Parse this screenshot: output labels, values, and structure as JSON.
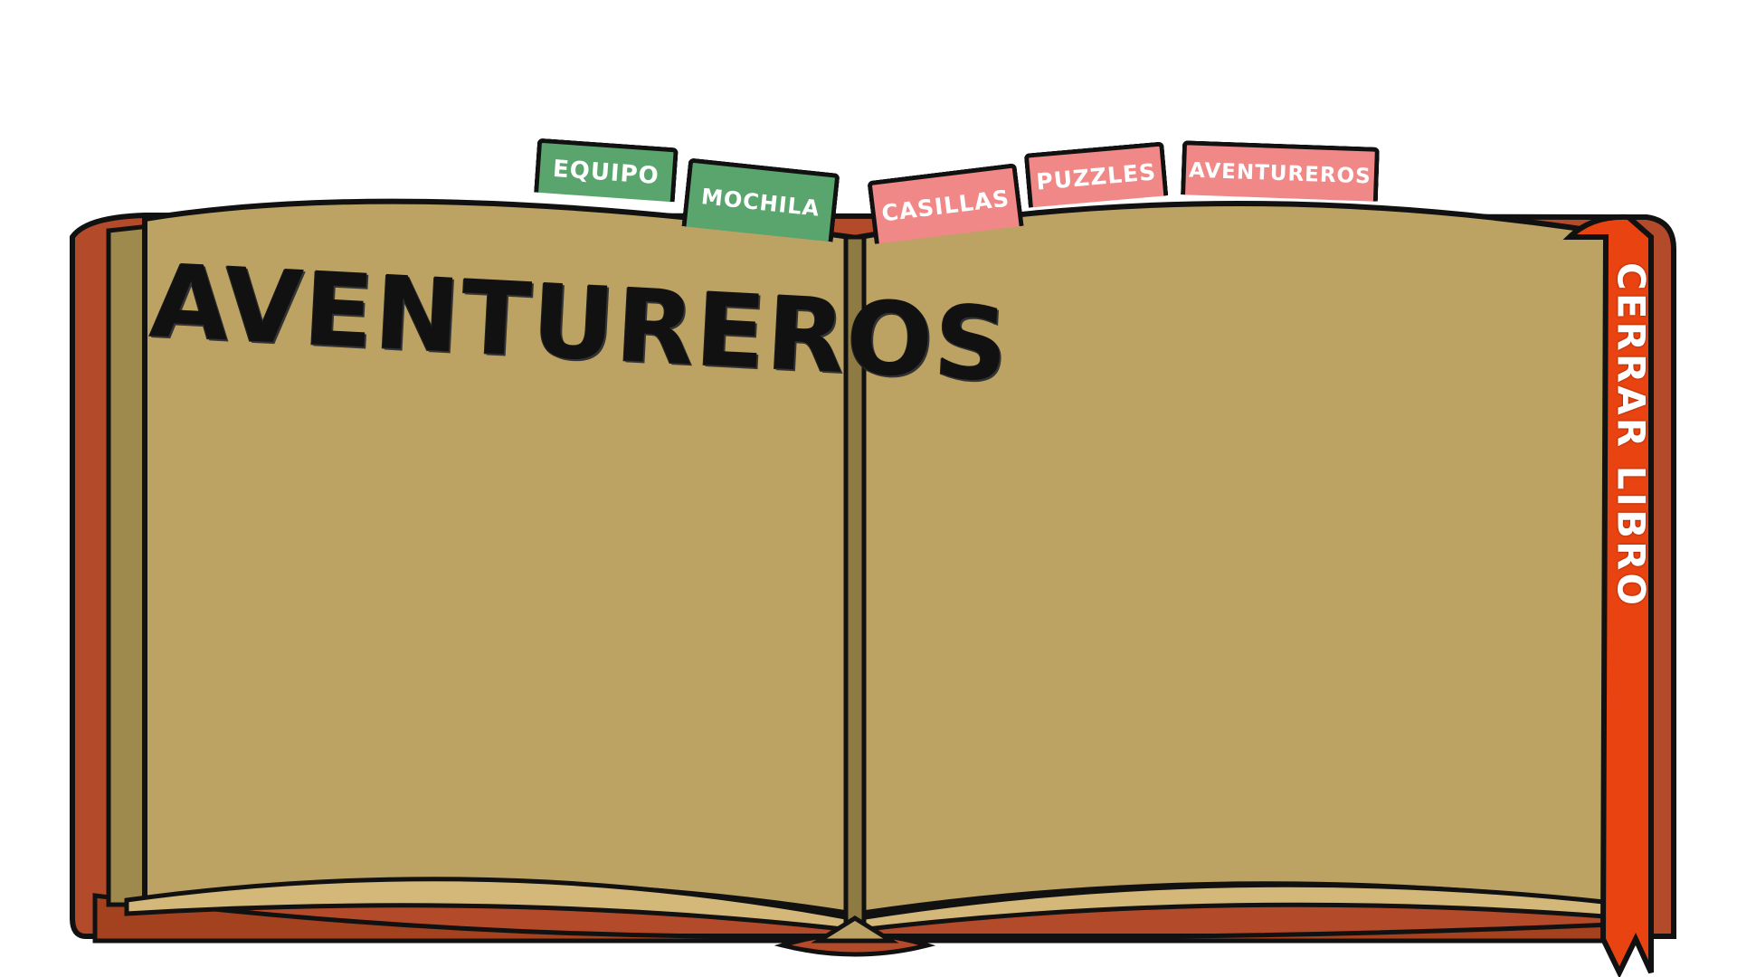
{
  "book": {
    "title": "AVENTUREROS",
    "tabs": [
      {
        "label": "EQUIPO",
        "color": "#5aa56e"
      },
      {
        "label": "MOCHILA",
        "color": "#5aa56e"
      },
      {
        "label": "CASILLAS",
        "color": "#f08888"
      },
      {
        "label": "PUZZLES",
        "color": "#f08888"
      },
      {
        "label": "AVENTUREROS",
        "color": "#f08888"
      }
    ],
    "bookmark": {
      "label": "CERRAR LIBRO",
      "color": "#e84310"
    }
  },
  "colors": {
    "page": "#bca363",
    "page_edge": "#d3b87a",
    "cover": "#b34a2a",
    "outline": "#111111"
  }
}
